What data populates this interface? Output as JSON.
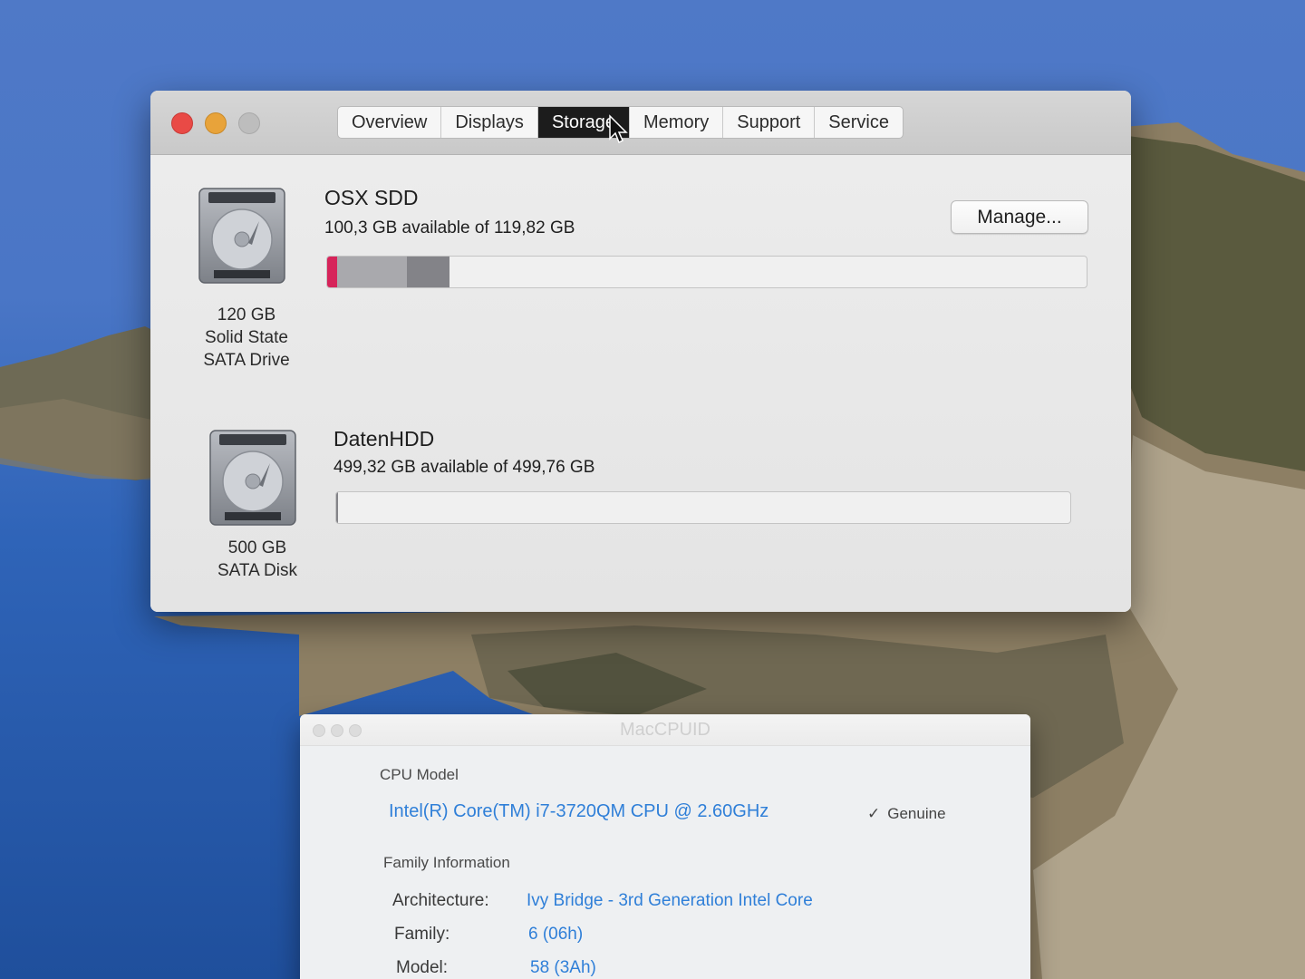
{
  "about_window": {
    "tabs": [
      {
        "label": "Overview",
        "active": false
      },
      {
        "label": "Displays",
        "active": false
      },
      {
        "label": "Storage",
        "active": true
      },
      {
        "label": "Memory",
        "active": false
      },
      {
        "label": "Support",
        "active": false
      },
      {
        "label": "Service",
        "active": false
      }
    ],
    "manage_label": "Manage...",
    "drives": [
      {
        "name": "OSX SDD",
        "availability": "100,3 GB available of 119,82 GB",
        "caption_lines": [
          "120 GB",
          "Solid State",
          "SATA Drive"
        ],
        "icon": "hard-drive-icon",
        "usage_segments": [
          {
            "label": "red",
            "fraction": 0.013,
            "color": "#d6245a"
          },
          {
            "label": "light-gray",
            "fraction": 0.092,
            "color": "#a9a9ad"
          },
          {
            "label": "dark-gray",
            "fraction": 0.056,
            "color": "#838388"
          }
        ]
      },
      {
        "name": "DatenHDD",
        "availability": "499,32 GB available of 499,76 GB",
        "caption_lines": [
          "500 GB",
          "SATA Disk"
        ],
        "icon": "hard-drive-icon",
        "usage_segments": [
          {
            "label": "dark-gray",
            "fraction": 0.003,
            "color": "#838388"
          }
        ]
      }
    ]
  },
  "cpuid_window": {
    "title": "MacCPUID",
    "cpu_model_label": "CPU Model",
    "cpu_model": "Intel(R) Core(TM) i7-3720QM CPU @ 2.60GHz",
    "genuine_label": "Genuine",
    "family_info_label": "Family Information",
    "rows": [
      {
        "key": "Architecture:",
        "value": "Ivy Bridge - 3rd Generation Intel Core"
      },
      {
        "key": "Family:",
        "value": "6 (06h)"
      },
      {
        "key": "Model:",
        "value": "58 (3Ah)"
      }
    ]
  },
  "colors": {
    "accent_blue": "#2f7fd8",
    "active_tab": "#1c1c1c",
    "close_button": "#e94a46",
    "minimize_button": "#e8a33a"
  }
}
